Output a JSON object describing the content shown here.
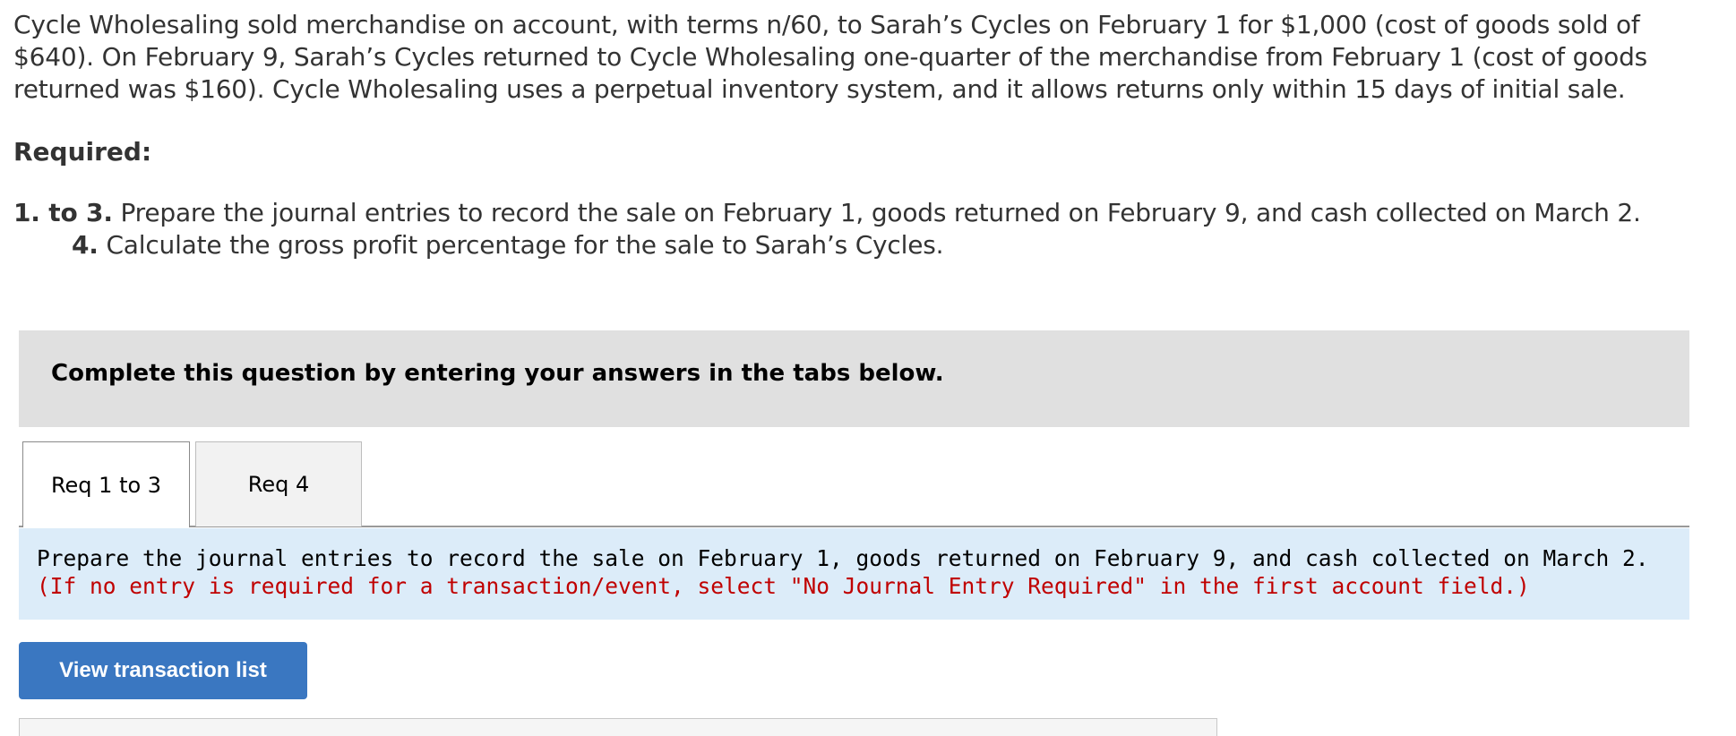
{
  "problem": {
    "text": "Cycle Wholesaling sold merchandise on account, with terms n/60, to Sarah’s Cycles on February 1 for $1,000 (cost of goods sold of $640). On February 9, Sarah’s Cycles returned to Cycle Wholesaling one-quarter of the merchandise from February 1 (cost of goods returned was $160). Cycle Wholesaling uses a perpetual inventory system, and it allows returns only within 15 days of initial sale."
  },
  "required": {
    "heading": "Required:",
    "items": [
      {
        "number": "1. to 3.",
        "text": "Prepare the journal entries to record the sale on February 1, goods returned on February 9, and cash collected on March 2."
      },
      {
        "number": "4.",
        "text": "Calculate the gross profit percentage for the sale to Sarah’s Cycles."
      }
    ]
  },
  "instruction": {
    "text": "Complete this question by entering your answers in the tabs below."
  },
  "tabs": [
    {
      "label": "Req 1 to 3",
      "active": true
    },
    {
      "label": "Req 4",
      "active": false
    }
  ],
  "content": {
    "text": "Prepare the journal entries to record the sale on February 1, goods returned on February 9, and cash collected on March 2.",
    "note": "(If no entry is required for a transaction/event, select \"No Journal Entry Required\" in the first account field.)"
  },
  "actions": {
    "view_transaction_list_label": "View transaction list"
  },
  "colors": {
    "instruction_bg": "#e0e0e0",
    "content_bg": "#dcecf9",
    "note_text": "#c00000",
    "button_bg": "#3a77c1"
  }
}
